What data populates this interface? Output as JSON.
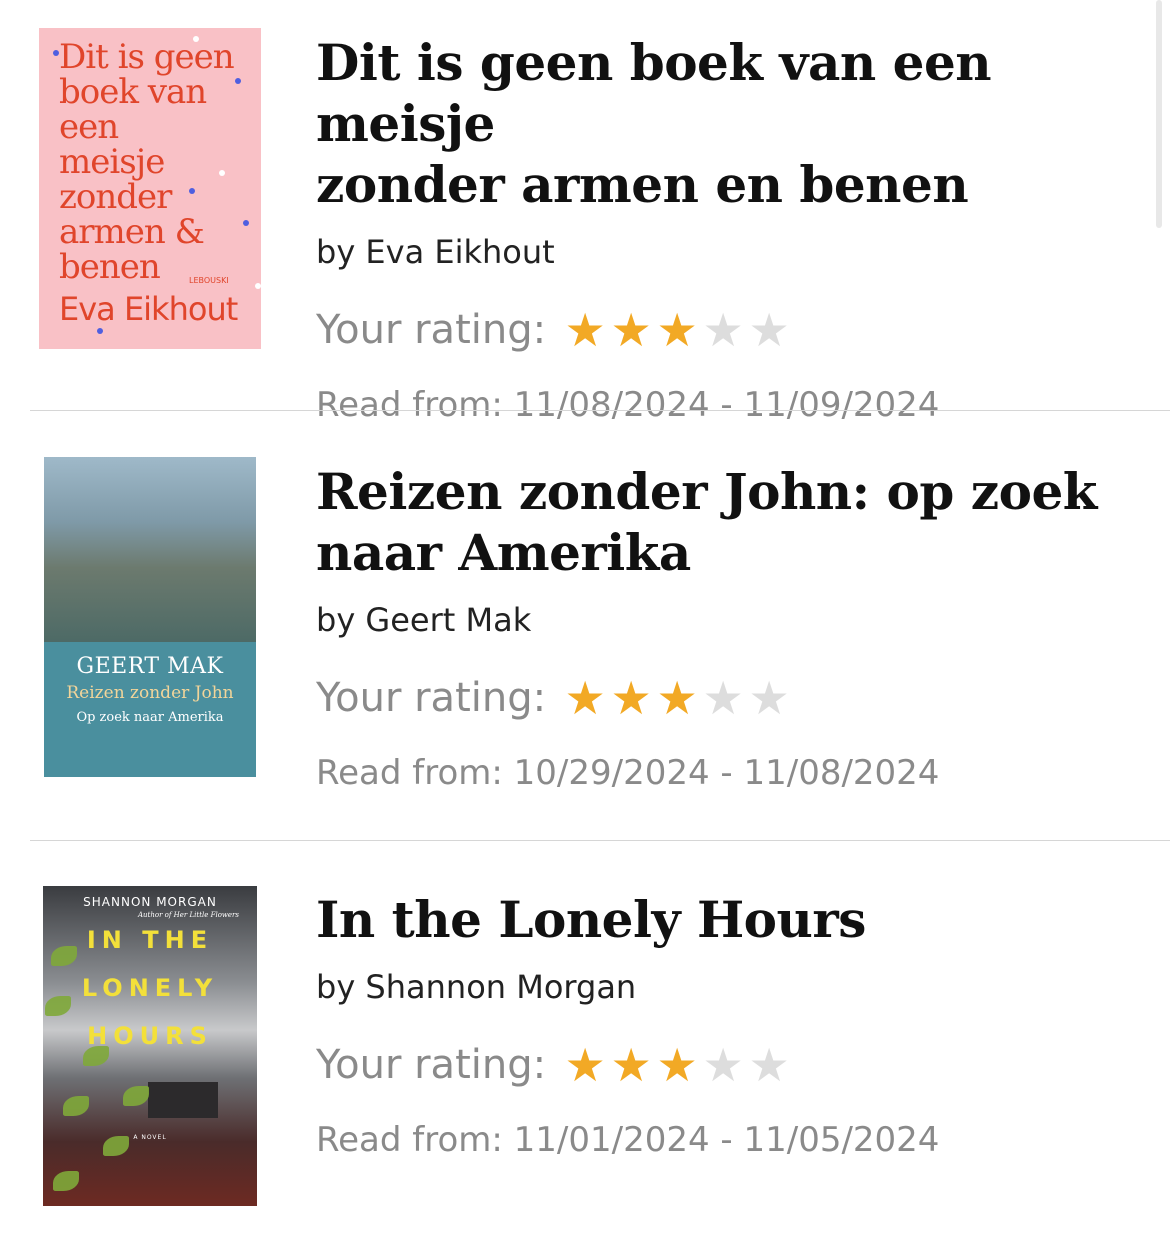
{
  "books": [
    {
      "title_line1": "Dit is geen boek van een meisje",
      "title_line2": "zonder armen en benen",
      "author": "by Eva Eikhout",
      "rating_label": "Your rating:",
      "rating": 3,
      "rating_max": 5,
      "dates": "Read from: 11/08/2024 - 11/09/2024",
      "cover": {
        "title_lines": "Dit is geen\nboek van\neen\nmeisje\nzonder\narmen &\nbenen",
        "author": "Eva Eikhout",
        "publisher": "LEBOUSKI",
        "bg": "#f9c1c6",
        "text_color": "#e0452b"
      }
    },
    {
      "title_line1": "Reizen zonder John: op zoek",
      "title_line2": "naar Amerika",
      "author": "by Geert Mak",
      "rating_label": "Your rating:",
      "rating": 3,
      "rating_max": 5,
      "dates": "Read from: 10/29/2024 - 11/08/2024",
      "cover": {
        "author": "GEERT MAK",
        "title": "Reizen zonder John",
        "subtitle": "Op zoek naar Amerika",
        "bg": "#4a8f9e"
      }
    },
    {
      "title_line1": "In the Lonely Hours",
      "title_line2": "",
      "author": "by Shannon Morgan",
      "rating_label": "Your rating:",
      "rating": 3,
      "rating_max": 5,
      "dates": "Read from: 11/01/2024 - 11/05/2024",
      "cover": {
        "author": "SHANNON MORGAN",
        "tagline": "Author of Her Little Flowers",
        "title_1": "IN THE",
        "title_2": "LONELY",
        "title_3": "HOURS",
        "novel": "A NOVEL"
      }
    }
  ],
  "colors": {
    "star_on": "#f2a925",
    "star_off": "#dddddd",
    "muted_text": "#8a8a8a",
    "divider": "#d6d6d6"
  }
}
